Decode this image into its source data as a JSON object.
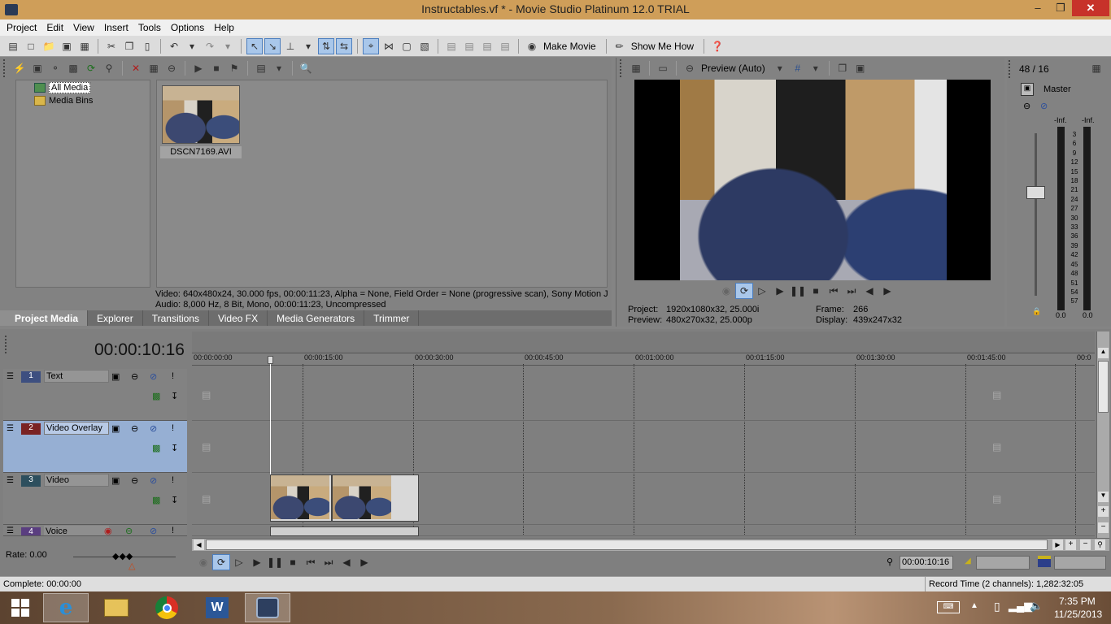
{
  "window": {
    "title": "Instructables.vf * - Movie Studio Platinum 12.0 TRIAL",
    "minimize": "–",
    "restore": "❐",
    "close": "✕"
  },
  "menu": [
    "Project",
    "Edit",
    "View",
    "Insert",
    "Tools",
    "Options",
    "Help"
  ],
  "toolbar": {
    "make_movie": "Make Movie",
    "show_me_how": "Show Me How"
  },
  "media": {
    "tree": [
      {
        "label": "All Media",
        "selected": true
      },
      {
        "label": "Media Bins",
        "selected": false
      }
    ],
    "file_name": "DSCN7169.AVI",
    "info_video": "Video: 640x480x24, 30.000 fps, 00:00:11:23, Alpha = None, Field Order = None (progressive scan), Sony Motion J",
    "info_audio": "Audio: 8,000 Hz, 8 Bit, Mono, 00:00:11:23, Uncompressed"
  },
  "tabs": [
    {
      "label": "Project Media",
      "active": true
    },
    {
      "label": "Explorer",
      "active": false
    },
    {
      "label": "Transitions",
      "active": false
    },
    {
      "label": "Video FX",
      "active": false
    },
    {
      "label": "Media Generators",
      "active": false
    },
    {
      "label": "Trimmer",
      "active": false
    }
  ],
  "preview": {
    "mode": "Preview (Auto)",
    "project_label": "Project:",
    "project_value": "1920x1080x32, 25.000i",
    "preview_label": "Preview:",
    "preview_value": "480x270x32, 25.000p",
    "frame_label": "Frame:",
    "frame_value": "266",
    "display_label": "Display:",
    "display_value": "439x247x32"
  },
  "mixer": {
    "counter": "48 / 16",
    "master": "Master",
    "peak_left": "-Inf.",
    "peak_right": "-Inf.",
    "scale": [
      "3",
      "6",
      "9",
      "12",
      "15",
      "18",
      "21",
      "24",
      "27",
      "30",
      "33",
      "36",
      "39",
      "42",
      "45",
      "48",
      "51",
      "54",
      "57"
    ],
    "bottom_left": "0.0",
    "bottom_right": "0.0"
  },
  "timeline": {
    "timecode": "00:00:10:16",
    "ticks": [
      "00:00:00:00",
      "00:00:15:00",
      "00:00:30:00",
      "00:00:45:00",
      "00:01:00:00",
      "00:01:15:00",
      "00:01:30:00",
      "00:01:45:00",
      "00:0"
    ],
    "tracks": [
      {
        "num": "1",
        "name": "Text",
        "color": "#3d4f80"
      },
      {
        "num": "2",
        "name": "Video Overlay",
        "color": "#7a2323"
      },
      {
        "num": "3",
        "name": "Video",
        "color": "#2d4f5e"
      },
      {
        "num": "4",
        "name": "Voice",
        "color": "#5a3e80"
      }
    ],
    "rate": "Rate: 0.00",
    "end_time": "00:00:10:16"
  },
  "status": {
    "left": "Complete: 00:00:00",
    "right": "Record Time (2 channels): 1,282:32:05"
  },
  "taskbar": {
    "time": "7:35 PM",
    "date": "11/25/2013"
  }
}
